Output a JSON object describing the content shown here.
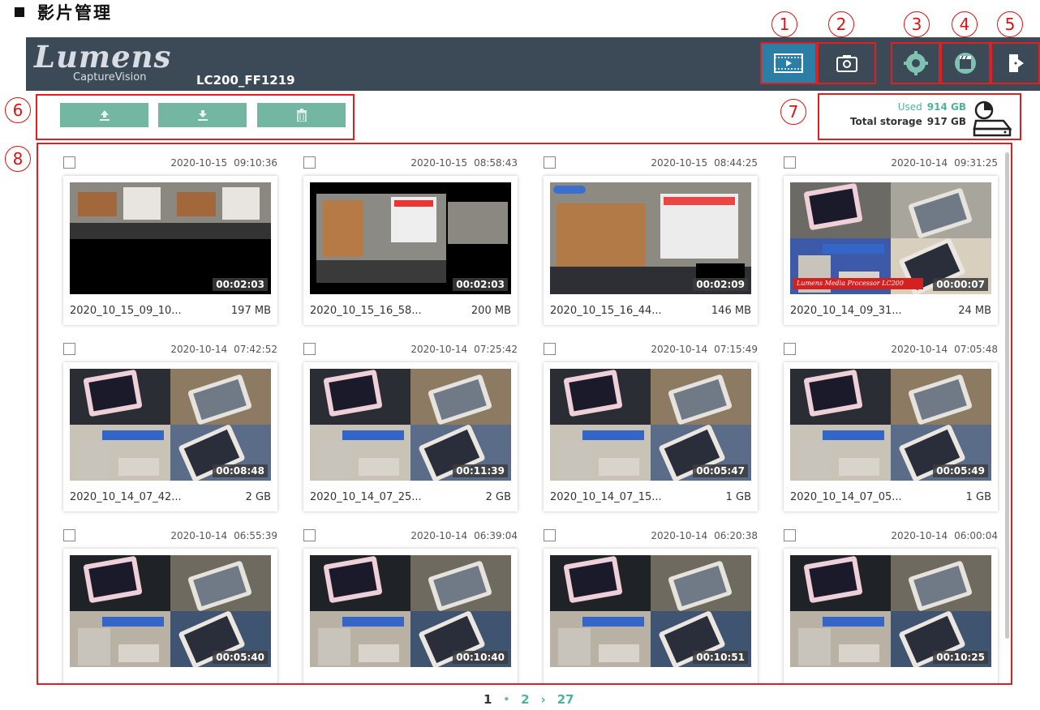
{
  "page": {
    "heading": "影片管理"
  },
  "callouts": [
    "1",
    "2",
    "3",
    "4",
    "5",
    "6",
    "7",
    "8"
  ],
  "header": {
    "logo_main": "Lumens",
    "logo_sub": "CaptureVision",
    "device_name": "LC200_FF1219",
    "buttons": [
      {
        "icon": "film-icon",
        "active": true
      },
      {
        "icon": "camera-icon",
        "active": false
      },
      {
        "icon": "gear-icon",
        "active": false
      },
      {
        "icon": "clapperboard-icon",
        "active": false
      },
      {
        "icon": "logout-icon",
        "active": false
      }
    ]
  },
  "toolbar": {
    "buttons": [
      "upload-icon",
      "download-icon",
      "trash-icon"
    ]
  },
  "storage": {
    "used_label": "Used",
    "used_value": "914 GB",
    "total_label": "Total storage",
    "total_value": "917 GB",
    "used_fraction": 0.997
  },
  "videos": [
    {
      "date": "2020-10-15",
      "time": "09:10:36",
      "duration": "00:02:03",
      "name": "2020_10_15_09_10...",
      "size": "197 MB"
    },
    {
      "date": "2020-10-15",
      "time": "08:58:43",
      "duration": "00:02:03",
      "name": "2020_10_15_16_58...",
      "size": "200 MB"
    },
    {
      "date": "2020-10-15",
      "time": "08:44:25",
      "duration": "00:02:09",
      "name": "2020_10_15_16_44...",
      "size": "146 MB"
    },
    {
      "date": "2020-10-14",
      "time": "09:31:25",
      "duration": "00:00:07",
      "name": "2020_10_14_09_31...",
      "size": "24 MB",
      "overlay": "Lumens Media Processor LC200"
    },
    {
      "date": "2020-10-14",
      "time": "07:42:52",
      "duration": "00:08:48",
      "name": "2020_10_14_07_42...",
      "size": "2 GB"
    },
    {
      "date": "2020-10-14",
      "time": "07:25:42",
      "duration": "00:11:39",
      "name": "2020_10_14_07_25...",
      "size": "2 GB"
    },
    {
      "date": "2020-10-14",
      "time": "07:15:49",
      "duration": "00:05:47",
      "name": "2020_10_14_07_15...",
      "size": "1 GB"
    },
    {
      "date": "2020-10-14",
      "time": "07:05:48",
      "duration": "00:05:49",
      "name": "2020_10_14_07_05...",
      "size": "1 GB"
    },
    {
      "date": "2020-10-14",
      "time": "06:55:39",
      "duration": "00:05:40",
      "name": "",
      "size": ""
    },
    {
      "date": "2020-10-14",
      "time": "06:39:04",
      "duration": "00:10:40",
      "name": "",
      "size": ""
    },
    {
      "date": "2020-10-14",
      "time": "06:20:38",
      "duration": "00:10:51",
      "name": "",
      "size": ""
    },
    {
      "date": "2020-10-14",
      "time": "06:00:04",
      "duration": "00:10:25",
      "name": "",
      "size": ""
    }
  ],
  "pagination": {
    "current": "1",
    "separator": "•",
    "next_page": "2",
    "next_arrow": "›",
    "last": "27"
  }
}
